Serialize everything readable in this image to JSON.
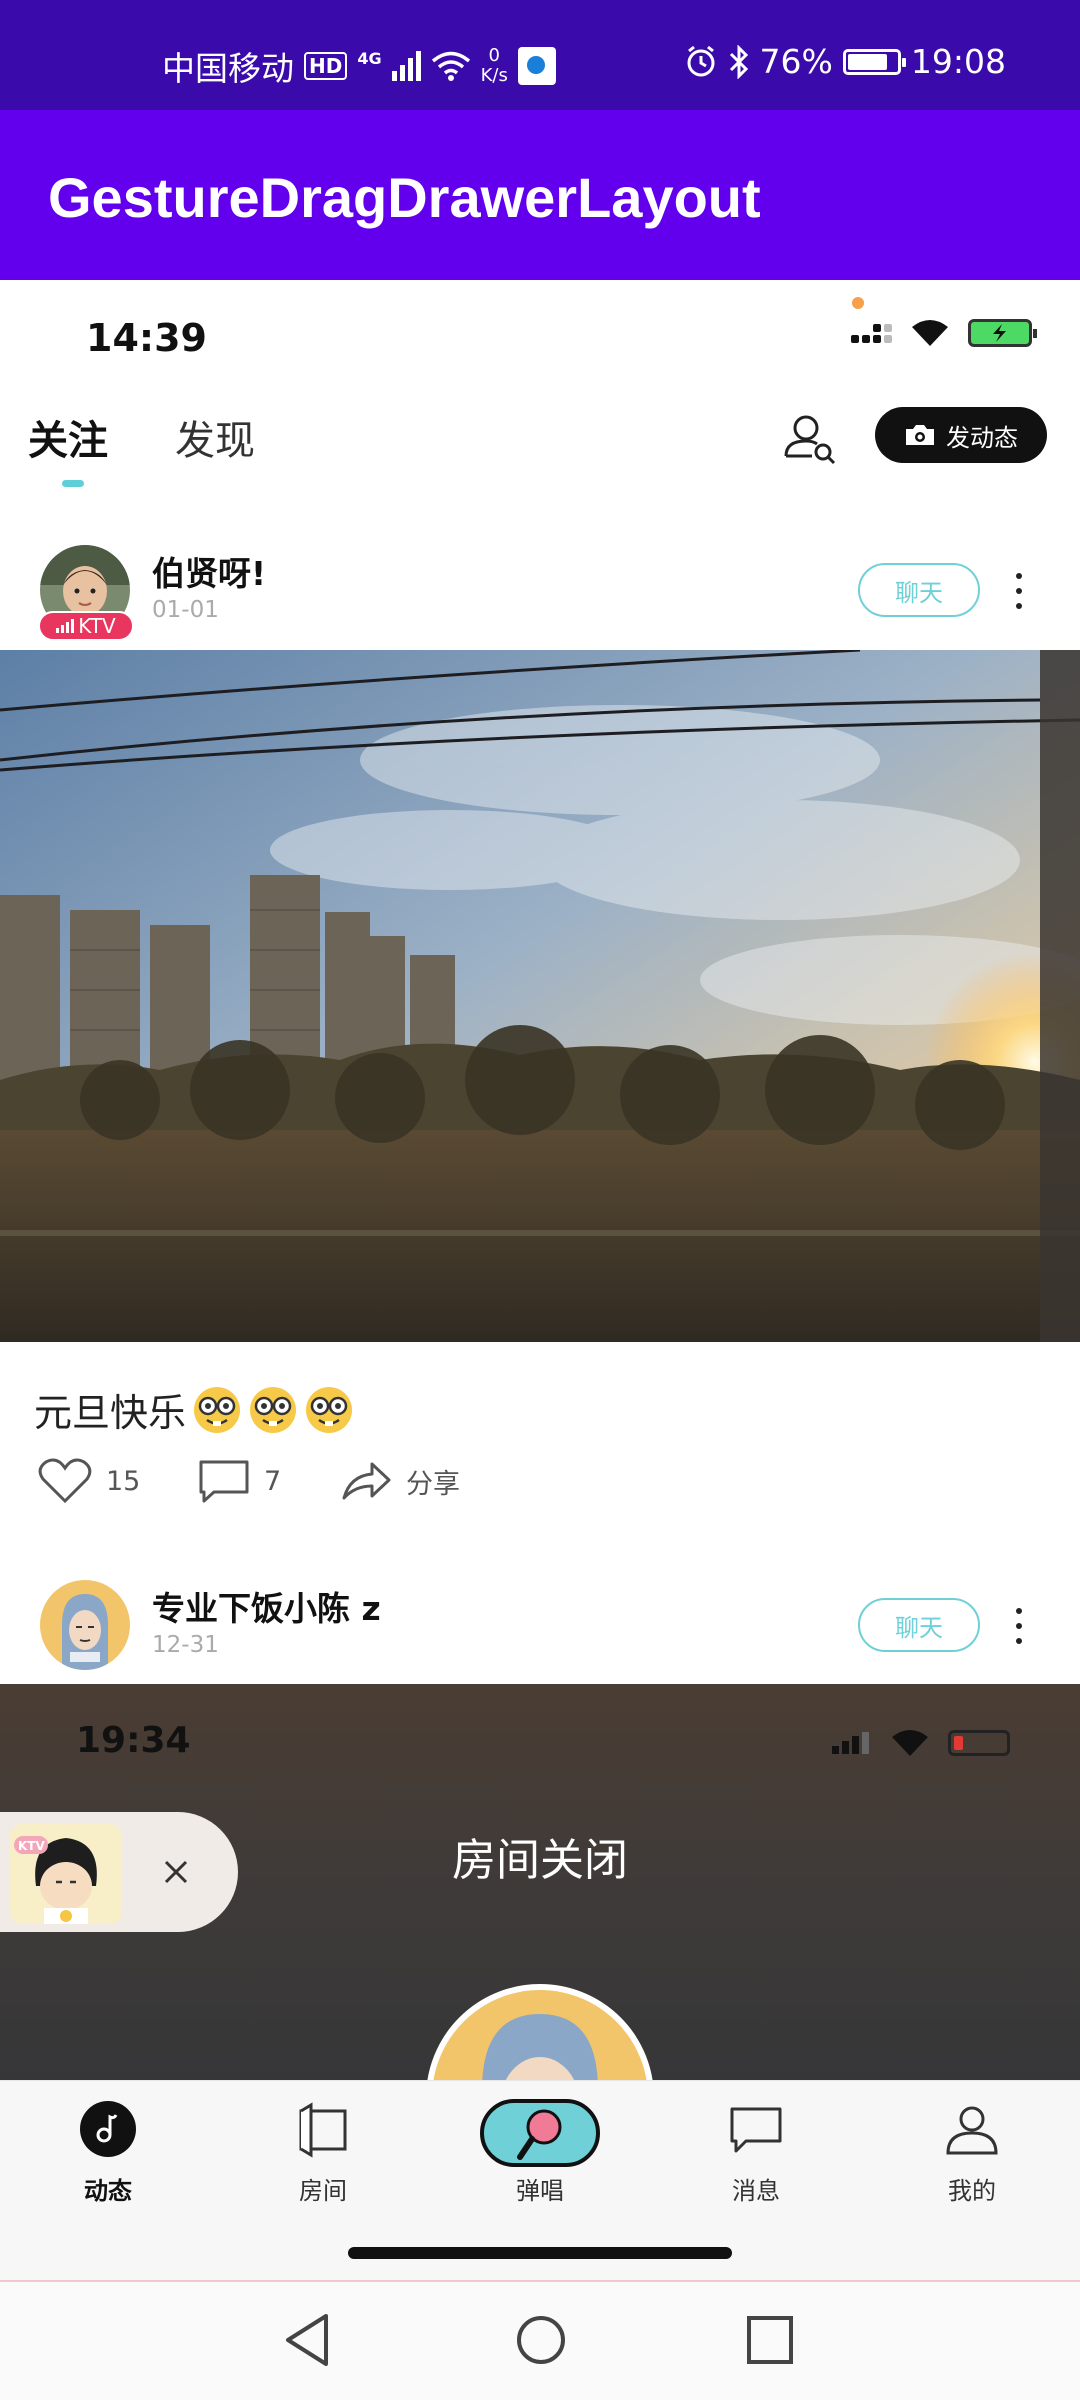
{
  "system_status": {
    "carrier": "中国移动",
    "hd": "HD",
    "network": "4G",
    "speed_value": "0",
    "speed_unit": "K/s",
    "battery": "76%",
    "battery_level": 0.76,
    "time": "19:08"
  },
  "app_bar": {
    "title": "GestureDragDrawerLayout"
  },
  "inner_status": {
    "time": "14:39"
  },
  "feed_tabs": {
    "follow": "关注",
    "discover": "发现",
    "post_button": "发动态"
  },
  "posts": [
    {
      "username": "伯贤呀!",
      "date": "01-01",
      "badge": "KTV",
      "chat": "聊天",
      "text": "元旦快乐",
      "likes": "15",
      "comments": "7",
      "share": "分享"
    },
    {
      "username": "专业下饭小陈 z",
      "date": "12-31",
      "chat": "聊天"
    }
  ],
  "room_card": {
    "time": "19:34",
    "title": "房间关闭",
    "badge": "KTV"
  },
  "bottom_nav": {
    "items": [
      {
        "label": "动态",
        "icon": "music-note-icon",
        "active": true
      },
      {
        "label": "房间",
        "icon": "room-icon"
      },
      {
        "label": "弹唱",
        "icon": "microphone-icon"
      },
      {
        "label": "消息",
        "icon": "message-icon"
      },
      {
        "label": "我的",
        "icon": "profile-icon"
      }
    ]
  },
  "colors": {
    "status_bar": "#3a0aab",
    "app_bar": "#6200ee",
    "accent": "#6fd0d7",
    "ktv": "#e8365f"
  }
}
